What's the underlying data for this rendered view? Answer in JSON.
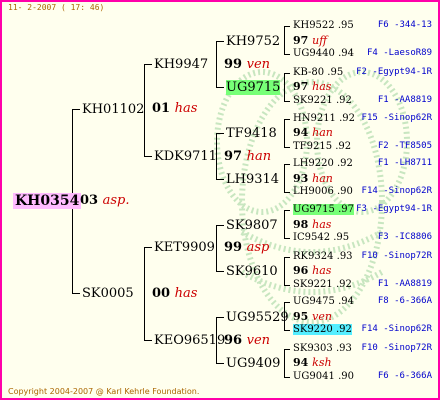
{
  "header": {
    "date": "11- 2-2007 ( 17: 46)"
  },
  "footer": {
    "copyright": "Copyright 2004-2007 @ Karl Kehrle Foundation."
  },
  "root": {
    "id": "KH0354"
  },
  "gen1": [
    {
      "id": "KH01102",
      "year": "01",
      "owner": "has"
    },
    {
      "id": "SK0005",
      "year": "00",
      "owner": "has"
    }
  ],
  "root_info": {
    "year": "03",
    "owner": "asp."
  },
  "gen2": [
    {
      "id": "KH9947",
      "year": "99",
      "owner": "ven"
    },
    {
      "id": "KDK9711",
      "year": "97",
      "owner": "han"
    },
    {
      "id": "KET9909",
      "year": "99",
      "owner": "asp"
    },
    {
      "id": "KEO96519",
      "year": "96",
      "owner": "ven"
    }
  ],
  "gen3": [
    {
      "id": "KH9752",
      "year": "97",
      "owner": "uff"
    },
    {
      "id": "UG9715",
      "year": "97",
      "owner": "has"
    },
    {
      "id": "TF9418",
      "year": "94",
      "owner": "han"
    },
    {
      "id": "LH9314",
      "year": "93",
      "owner": "han"
    },
    {
      "id": "SK9807",
      "year": "98",
      "owner": "has"
    },
    {
      "id": "SK9610",
      "year": "96",
      "owner": "has"
    },
    {
      "id": "UG95529",
      "year": "95",
      "owner": "ven"
    },
    {
      "id": "UG9409",
      "year": "94",
      "owner": "ksh"
    }
  ],
  "gen4": [
    {
      "id": "KH9522",
      "year": ".95",
      "line": "F6 -344-13"
    },
    {
      "id": "UG9440",
      "year": ".94",
      "line": "F4 -LaesoR89"
    },
    {
      "id": "KB-80",
      "year": ".95",
      "line": "F2 -Egypt94-1R"
    },
    {
      "id": "SK9221",
      "year": ".92",
      "line": "F1 -AA8819"
    },
    {
      "id": "HN9211",
      "year": ".92",
      "line": "F15 -Sinop62R"
    },
    {
      "id": "TF9215",
      "year": ".92",
      "line": "F2 -TF8505"
    },
    {
      "id": "LH9220",
      "year": ".92",
      "line": "F1 -LH8711"
    },
    {
      "id": "LH9006",
      "year": ".90",
      "line": "F14 -Sinop62R"
    },
    {
      "id": "UG9715",
      "year": ".97",
      "line": "F3 -Egypt94-1R"
    },
    {
      "id": "IC9542",
      "year": ".95",
      "line": "F3 -IC8806"
    },
    {
      "id": "RK9324",
      "year": ".93",
      "line": "F10 -Sinop72R"
    },
    {
      "id": "SK9221",
      "year": ".92",
      "line": "F1 -AA8819"
    },
    {
      "id": "UG9475",
      "year": ".94",
      "line": "F8 -6-366A"
    },
    {
      "id": "SK9220",
      "year": ".92",
      "line": "F14 -Sinop62R"
    },
    {
      "id": "SK9303",
      "year": ".93",
      "line": "F10 -Sinop72R"
    },
    {
      "id": "UG9041",
      "year": ".90",
      "line": "F6 -6-366A"
    }
  ]
}
